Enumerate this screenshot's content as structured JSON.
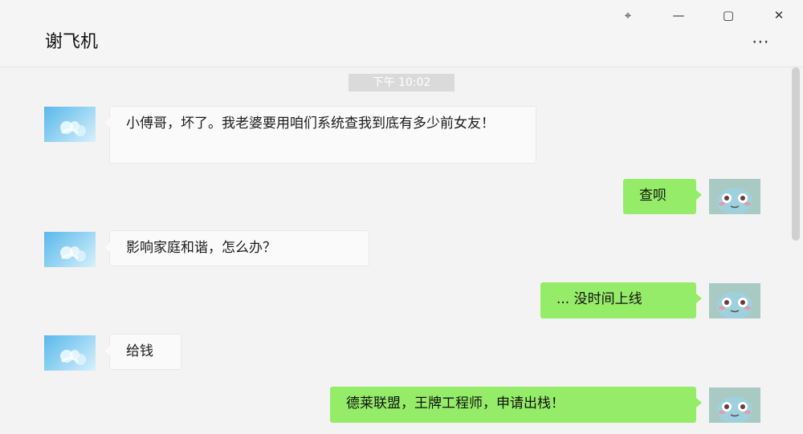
{
  "window": {
    "title": "谢飞机",
    "controls": {
      "pin": "⌖",
      "minimize": "—",
      "maximize": "▢",
      "close": "✕"
    },
    "more_label": "⋯"
  },
  "chat": {
    "timestamp": "下午 10:02",
    "messages": [
      {
        "side": "left",
        "text": "小傅哥，坏了。我老婆要用咱们系统查我到底有多少前女友！"
      },
      {
        "side": "right",
        "text": "查呗"
      },
      {
        "side": "left",
        "text": "影响家庭和谐，怎么办？"
      },
      {
        "side": "right",
        "text": "... 没时间上线"
      },
      {
        "side": "left",
        "text": "给钱"
      },
      {
        "side": "right",
        "text": "德莱联盟，王牌工程师，申请出栈！"
      }
    ]
  },
  "colors": {
    "right_bubble": "#95ec69",
    "left_bubble": "#fafafa",
    "background": "#f3f3f3"
  }
}
